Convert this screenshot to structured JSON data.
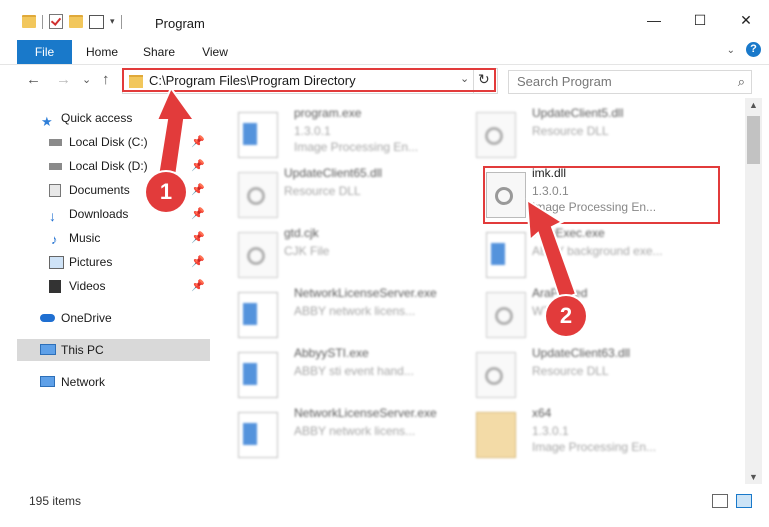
{
  "window": {
    "title": "Program",
    "controls": {
      "minimize": "—",
      "maximize": "☐",
      "close": "✕"
    }
  },
  "ribbon": {
    "tabs": [
      "File",
      "Home",
      "Share",
      "View"
    ],
    "expand_icon": "chevron-down-icon"
  },
  "nav": {
    "back": "←",
    "forward": "→",
    "recent": "⌄",
    "up": "↑",
    "address": "C:\\Program Files\\Program Directory",
    "search_placeholder": "Search Program"
  },
  "sidebar": {
    "items": [
      {
        "label": "Quick access",
        "icon": "star-icon",
        "pinned": false
      },
      {
        "label": "Local Disk (C:)",
        "icon": "drive-icon",
        "pinned": true
      },
      {
        "label": "Local Disk (D:)",
        "icon": "drive-icon",
        "pinned": true
      },
      {
        "label": "Documents",
        "icon": "documents-icon",
        "pinned": true
      },
      {
        "label": "Downloads",
        "icon": "download-icon",
        "pinned": true
      },
      {
        "label": "Music",
        "icon": "music-icon",
        "pinned": true
      },
      {
        "label": "Pictures",
        "icon": "pictures-icon",
        "pinned": true
      },
      {
        "label": "Videos",
        "icon": "videos-icon",
        "pinned": true
      },
      {
        "label": "OneDrive",
        "icon": "cloud-icon",
        "pinned": false
      },
      {
        "label": "This PC",
        "icon": "computer-icon",
        "pinned": false,
        "selected": true
      },
      {
        "label": "Network",
        "icon": "network-icon",
        "pinned": false
      }
    ]
  },
  "files": [
    {
      "name": "program.exe",
      "line2": "1.3.0.1",
      "line3": "Image Processing En...",
      "type": "exe"
    },
    {
      "name": "UpdateClient5.dll",
      "line2": "Resource DLL",
      "line3": "",
      "type": "dll"
    },
    {
      "name": "UpdateClient65.dll",
      "line2": "Resource DLL",
      "line3": "",
      "type": "dll"
    },
    {
      "name": "imk.dll",
      "line2": "1.3.0.1",
      "line3": "Image Processing En...",
      "type": "dll",
      "highlighted": true
    },
    {
      "name": "gtd.cjk",
      "line2": "CJK File",
      "line3": "",
      "type": "doc"
    },
    {
      "name": "FineExec.exe",
      "line2": "ABBY background exe...",
      "line3": "",
      "type": "exe"
    },
    {
      "name": "NetworkLicenseServer.exe",
      "line2": "ABBY network licens...",
      "line3": "",
      "type": "exe"
    },
    {
      "name": "AraPlaced",
      "line2": "WT...",
      "line3": "",
      "type": "doc"
    },
    {
      "name": "AbbyySTI.exe",
      "line2": "ABBY sti event hand...",
      "line3": "",
      "type": "exe"
    },
    {
      "name": "UpdateClient63.dll",
      "line2": "Resource DLL",
      "line3": "",
      "type": "dll"
    },
    {
      "name": "NetworkLicenseServer.exe",
      "line2": "ABBY network licens...",
      "line3": "",
      "type": "exe"
    },
    {
      "name": "x64",
      "line2": "1.3.0.1",
      "line3": "Image Processing En...",
      "type": "zip"
    }
  ],
  "status": {
    "item_count": "195 items"
  },
  "callouts": {
    "step1": "1",
    "step2": "2"
  },
  "colors": {
    "accent": "#1979ca",
    "highlight": "#e23b3b",
    "selected_bg": "#d9d9d9"
  }
}
